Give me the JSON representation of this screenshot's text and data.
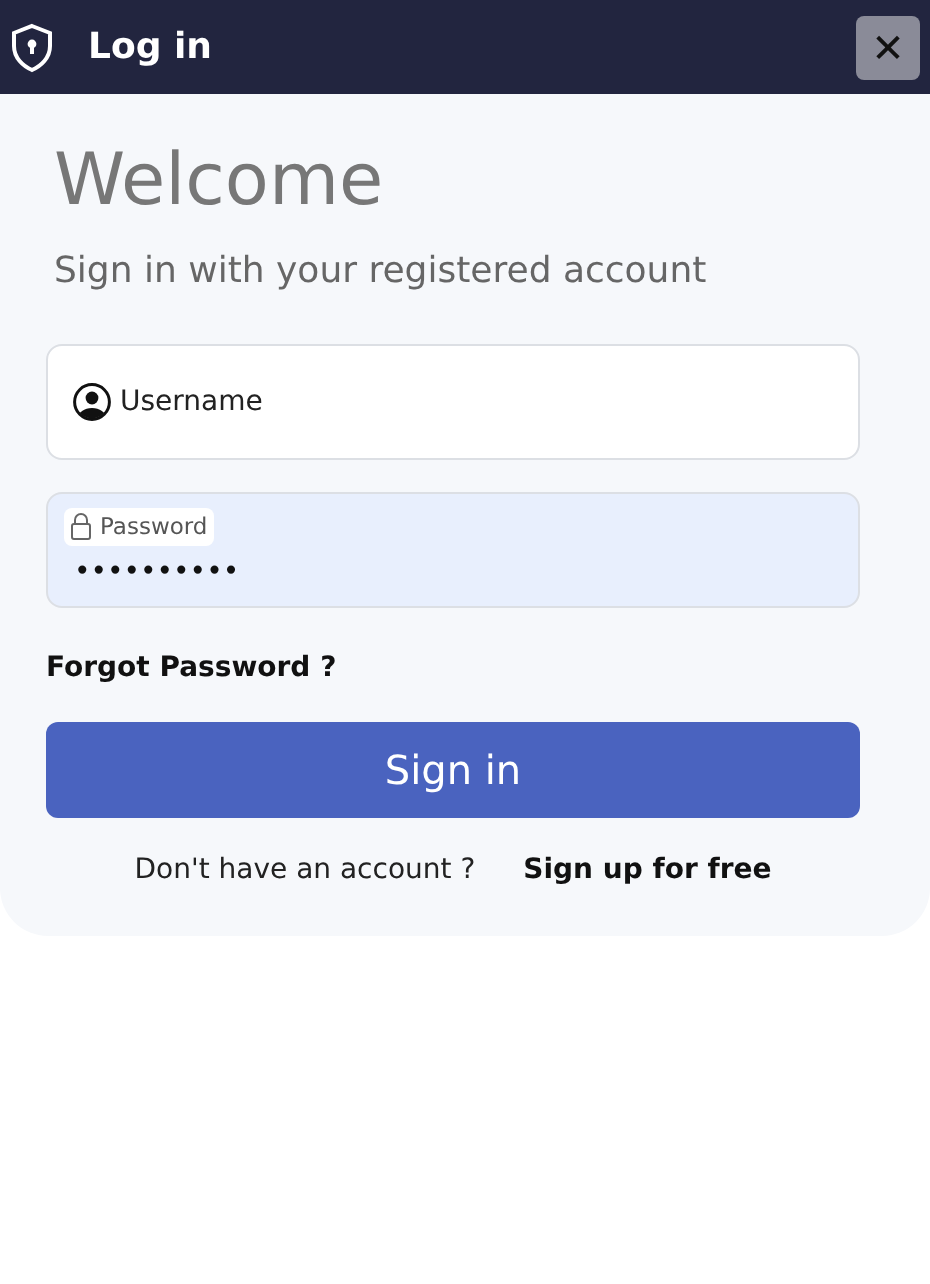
{
  "window": {
    "title": "Log in",
    "close": "✕"
  },
  "heading": "Welcome",
  "subheading": "Sign in with your registered account",
  "fields": [
    {
      "kind": "plain",
      "placeholder": "Username"
    },
    {
      "kind": "floating",
      "label": "Password",
      "value": "••••••••••",
      "focused": true
    }
  ],
  "forgot_link": "Forgot Password ?",
  "submit": "Sign in",
  "signup": {
    "prompt": "Don't have an account ?",
    "link": "Sign up for free"
  }
}
